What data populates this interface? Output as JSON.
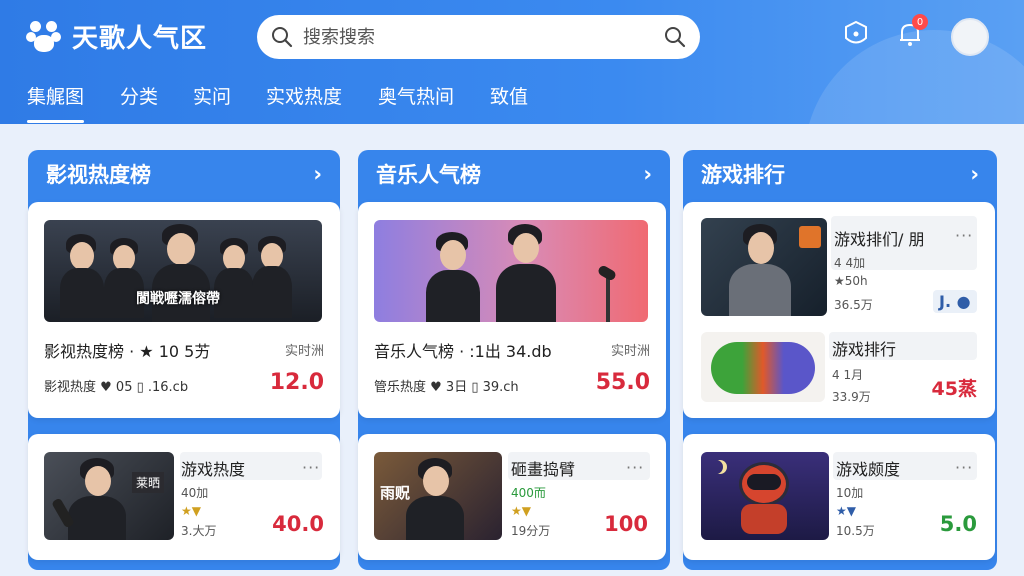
{
  "app": {
    "title": "天歌人气区"
  },
  "search": {
    "placeholder": "搜索搜索"
  },
  "header": {
    "badge_count": "0"
  },
  "tabs": [
    {
      "label": "集艉图"
    },
    {
      "label": "分类"
    },
    {
      "label": "实问"
    },
    {
      "label": "实戏热度"
    },
    {
      "label": "奥气热间"
    },
    {
      "label": "致值"
    }
  ],
  "columns": [
    {
      "title": "影视热度榜",
      "feature": {
        "title": "影视热度榜 · ★ 10 5艻",
        "tag": "实时洲",
        "stats": "影视热度 ♥ 05  ▯ .16.cb",
        "score": "12.0",
        "banner_text": "閬戦嚦濡傛帶"
      },
      "item": {
        "title": "游戏热度",
        "line1": "40加",
        "line2": "★▼",
        "line3": "3.大万",
        "score": "40.0",
        "overlay": "莱晒"
      }
    },
    {
      "title": "音乐人气榜",
      "feature": {
        "title": "音乐人气榜 · ꞉1出 34.db",
        "tag": "实时洲",
        "stats": "管乐热度 ♥ 3日  ▯ 39.ch",
        "score": "55.0"
      },
      "item": {
        "title": "砸畫捣臂",
        "line1": "400而",
        "line2": "★▼",
        "line3": "19分万",
        "score": "100",
        "overlay": "雨贶"
      }
    },
    {
      "title": "游戏排行",
      "items": [
        {
          "title": "游戏排们/ 朋",
          "line1": "4 4加",
          "line2": "★50h",
          "line3": "36.5万",
          "score": "J. ●"
        },
        {
          "title": "游戏排行",
          "line1": "4 1月",
          "line2": "33.9万",
          "score": "45蒸"
        },
        {
          "title": "游戏颇度",
          "line1": "10加",
          "line2": "★▼",
          "line3": "10.5万",
          "score": "5.0"
        }
      ]
    }
  ],
  "colors": {
    "primary": "#2f7be6",
    "score_red": "#d82a3c",
    "score_green": "#2a9a3c"
  }
}
